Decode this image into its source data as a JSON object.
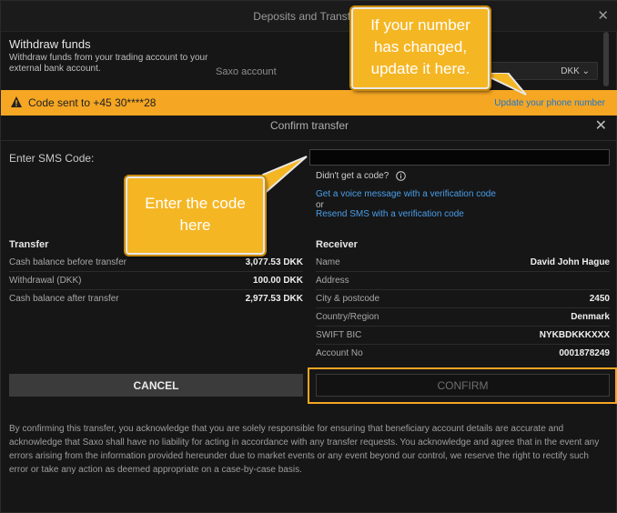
{
  "background_window": {
    "title": "Deposits and Transfers",
    "close_glyph": "✕",
    "withdraw_title": "Withdraw funds",
    "withdraw_description": "Withdraw funds from your trading account to your external bank account.",
    "account_label": "Saxo account",
    "currency_value": "DKK"
  },
  "banner": {
    "text": "Code sent to +45 30****28",
    "link": "Update your phone number",
    "icon": "warning-icon",
    "color": "#f5a623"
  },
  "modal": {
    "title": "Confirm transfer",
    "close_glyph": "✕",
    "sms_label": "Enter SMS Code:",
    "sms_value": "",
    "no_code_text": "Didn't get a code?",
    "voice_link": "Get a voice message with a verification code",
    "or_text": "or",
    "resend_link": "Resend SMS with a verification code"
  },
  "transfer": {
    "heading": "Transfer",
    "rows": [
      {
        "label": "Cash balance before transfer",
        "value": "3,077.53 DKK"
      },
      {
        "label": "Withdrawal (DKK)",
        "value": "100.00 DKK"
      },
      {
        "label": "Cash balance after transfer",
        "value": "2,977.53 DKK"
      }
    ]
  },
  "receiver": {
    "heading": "Receiver",
    "rows": [
      {
        "label": "Name",
        "value": "David John Hague"
      },
      {
        "label": "Address",
        "value": ""
      },
      {
        "label": "City & postcode",
        "value": "2450"
      },
      {
        "label": "Country/Region",
        "value": "Denmark"
      },
      {
        "label": "SWIFT BIC",
        "value": "NYKBDKKKXXX"
      },
      {
        "label": "Account No",
        "value": "0001878249"
      }
    ]
  },
  "buttons": {
    "cancel": "CANCEL",
    "confirm": "CONFIRM"
  },
  "disclaimer": "By confirming this transfer, you acknowledge that you are solely responsible for ensuring that beneficiary account details are accurate and acknowledge that Saxo shall have no liability for acting in accordance with any transfer requests. You acknowledge and agree that in the event any errors arising from the information provided hereunder due to market events or any event beyond our control, we reserve the right to rectify such error or take any action as deemed appropriate on a case-by-case basis.",
  "callouts": {
    "phone": "If your number has changed, update it here.",
    "code": "Enter the code here",
    "color": "#f5b624"
  }
}
